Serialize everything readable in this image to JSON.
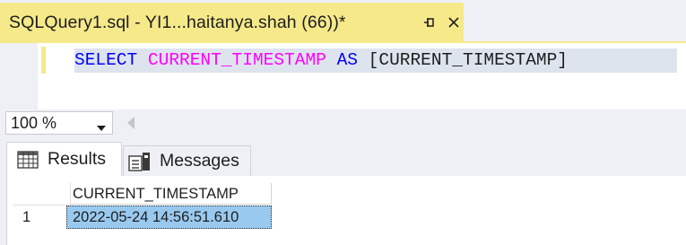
{
  "document_tab": {
    "title": "SQLQuery1.sql - YI1...haitanya.shah (66))*",
    "pin_icon": "pin-icon",
    "close_icon": "close-icon",
    "accent_color": "#f5e98a"
  },
  "editor": {
    "code": {
      "keyword_select": "SELECT",
      "function_name": "CURRENT_TIMESTAMP",
      "keyword_as": "AS",
      "alias": "[CURRENT_TIMESTAMP]"
    },
    "colors": {
      "keyword": "#0000ff",
      "function": "#ff00ff",
      "selection": "#dee4ee"
    }
  },
  "zoom": {
    "value": "100 %"
  },
  "results_tabs": [
    {
      "label": "Results",
      "icon": "grid-icon",
      "active": true
    },
    {
      "label": "Messages",
      "icon": "messages-icon",
      "active": false
    }
  ],
  "grid": {
    "columns": [
      "CURRENT_TIMESTAMP"
    ],
    "rows": [
      {
        "number": "1",
        "cells": [
          "2022-05-24 14:56:51.610"
        ]
      }
    ],
    "selected_cell_color": "#99c9ef"
  }
}
